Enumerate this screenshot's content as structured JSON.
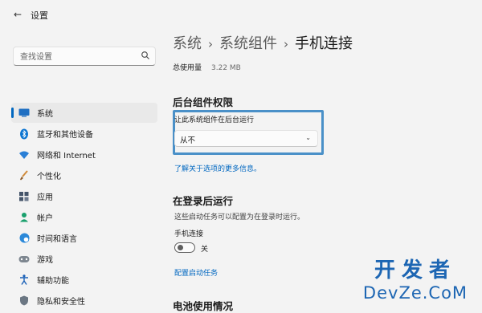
{
  "titlebar": {
    "title": "设置",
    "back_icon": "back-arrow-icon"
  },
  "search": {
    "placeholder": "查找设置",
    "icon": "search-icon"
  },
  "sidebar": {
    "items": [
      {
        "label": "系统",
        "icon": "monitor-icon",
        "active": true
      },
      {
        "label": "蓝牙和其他设备",
        "icon": "bluetooth-icon"
      },
      {
        "label": "网络和 Internet",
        "icon": "wifi-icon"
      },
      {
        "label": "个性化",
        "icon": "paintbrush-icon"
      },
      {
        "label": "应用",
        "icon": "apps-icon"
      },
      {
        "label": "帐户",
        "icon": "person-icon"
      },
      {
        "label": "时间和语言",
        "icon": "globe-clock-icon"
      },
      {
        "label": "游戏",
        "icon": "gamepad-icon"
      },
      {
        "label": "辅助功能",
        "icon": "accessibility-icon"
      },
      {
        "label": "隐私和安全性",
        "icon": "shield-icon"
      }
    ]
  },
  "breadcrumb": {
    "item1": "系统",
    "item2": "系统组件",
    "current": "手机连接",
    "separator": "›"
  },
  "usage": {
    "label": "总使用量",
    "value": "3.22 MB"
  },
  "background": {
    "title": "后台组件权限",
    "setting_label": "让此系统组件在后台运行",
    "dropdown_value": "从不",
    "link": "了解关于选项的更多信息。"
  },
  "startup": {
    "title": "在登录后运行",
    "description": "这些启动任务可以配置为在登录时运行。",
    "task_name": "手机连接",
    "toggle_state": "关",
    "toggle_on": false,
    "link": "配置启动任务"
  },
  "battery": {
    "title": "电池使用情况"
  },
  "watermark": {
    "line1": "开发者",
    "line2": "DevZe.CoM"
  },
  "colors": {
    "accent": "#0067c0",
    "focus_frame": "#4a90c8",
    "watermark": "#1d66b3"
  }
}
